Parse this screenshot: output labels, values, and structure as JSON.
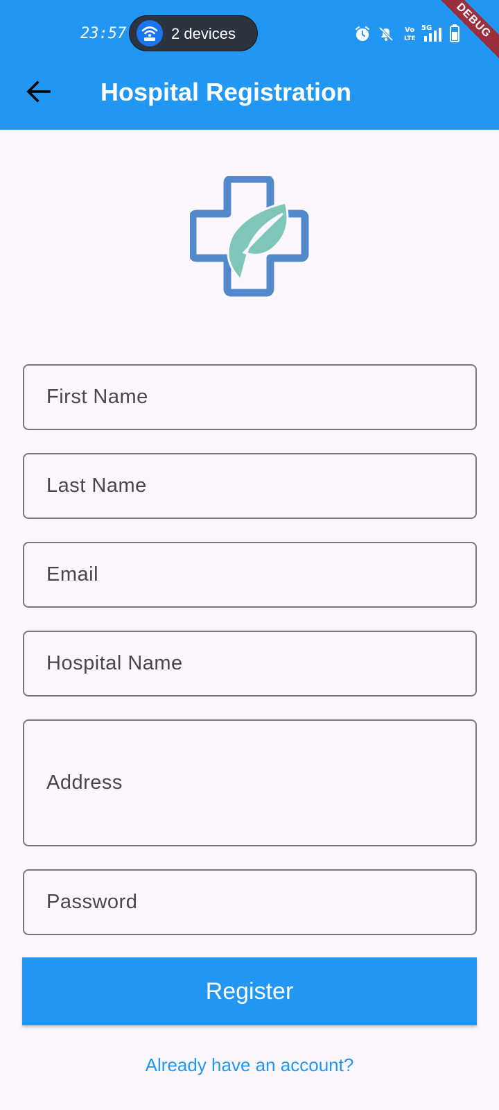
{
  "status_bar": {
    "time": "23:57",
    "hotspot_label": "2 devices",
    "icons": [
      "alarm-icon",
      "mute-icon",
      "volte-icon",
      "5g-signal-icon",
      "battery-icon"
    ]
  },
  "debug_banner": "DEBUG",
  "app_bar": {
    "title": "Hospital Registration",
    "back_icon": "arrow-left-icon",
    "color": "#2196f3"
  },
  "logo": {
    "icon": "medical-cross-leaf-logo",
    "cross_color": "#5289cb",
    "leaf_color": "#7dc6b9"
  },
  "form": {
    "fields": [
      {
        "label": "First Name",
        "value": ""
      },
      {
        "label": "Last Name",
        "value": ""
      },
      {
        "label": "Email",
        "value": ""
      },
      {
        "label": "Hospital Name",
        "value": ""
      },
      {
        "label": "Address",
        "value": ""
      },
      {
        "label": "Password",
        "value": ""
      }
    ],
    "submit_label": "Register",
    "login_link": "Already have an account?"
  },
  "colors": {
    "accent": "#2196f3",
    "background": "#fcf7fd",
    "border": "#79747e",
    "label": "#49454f"
  }
}
